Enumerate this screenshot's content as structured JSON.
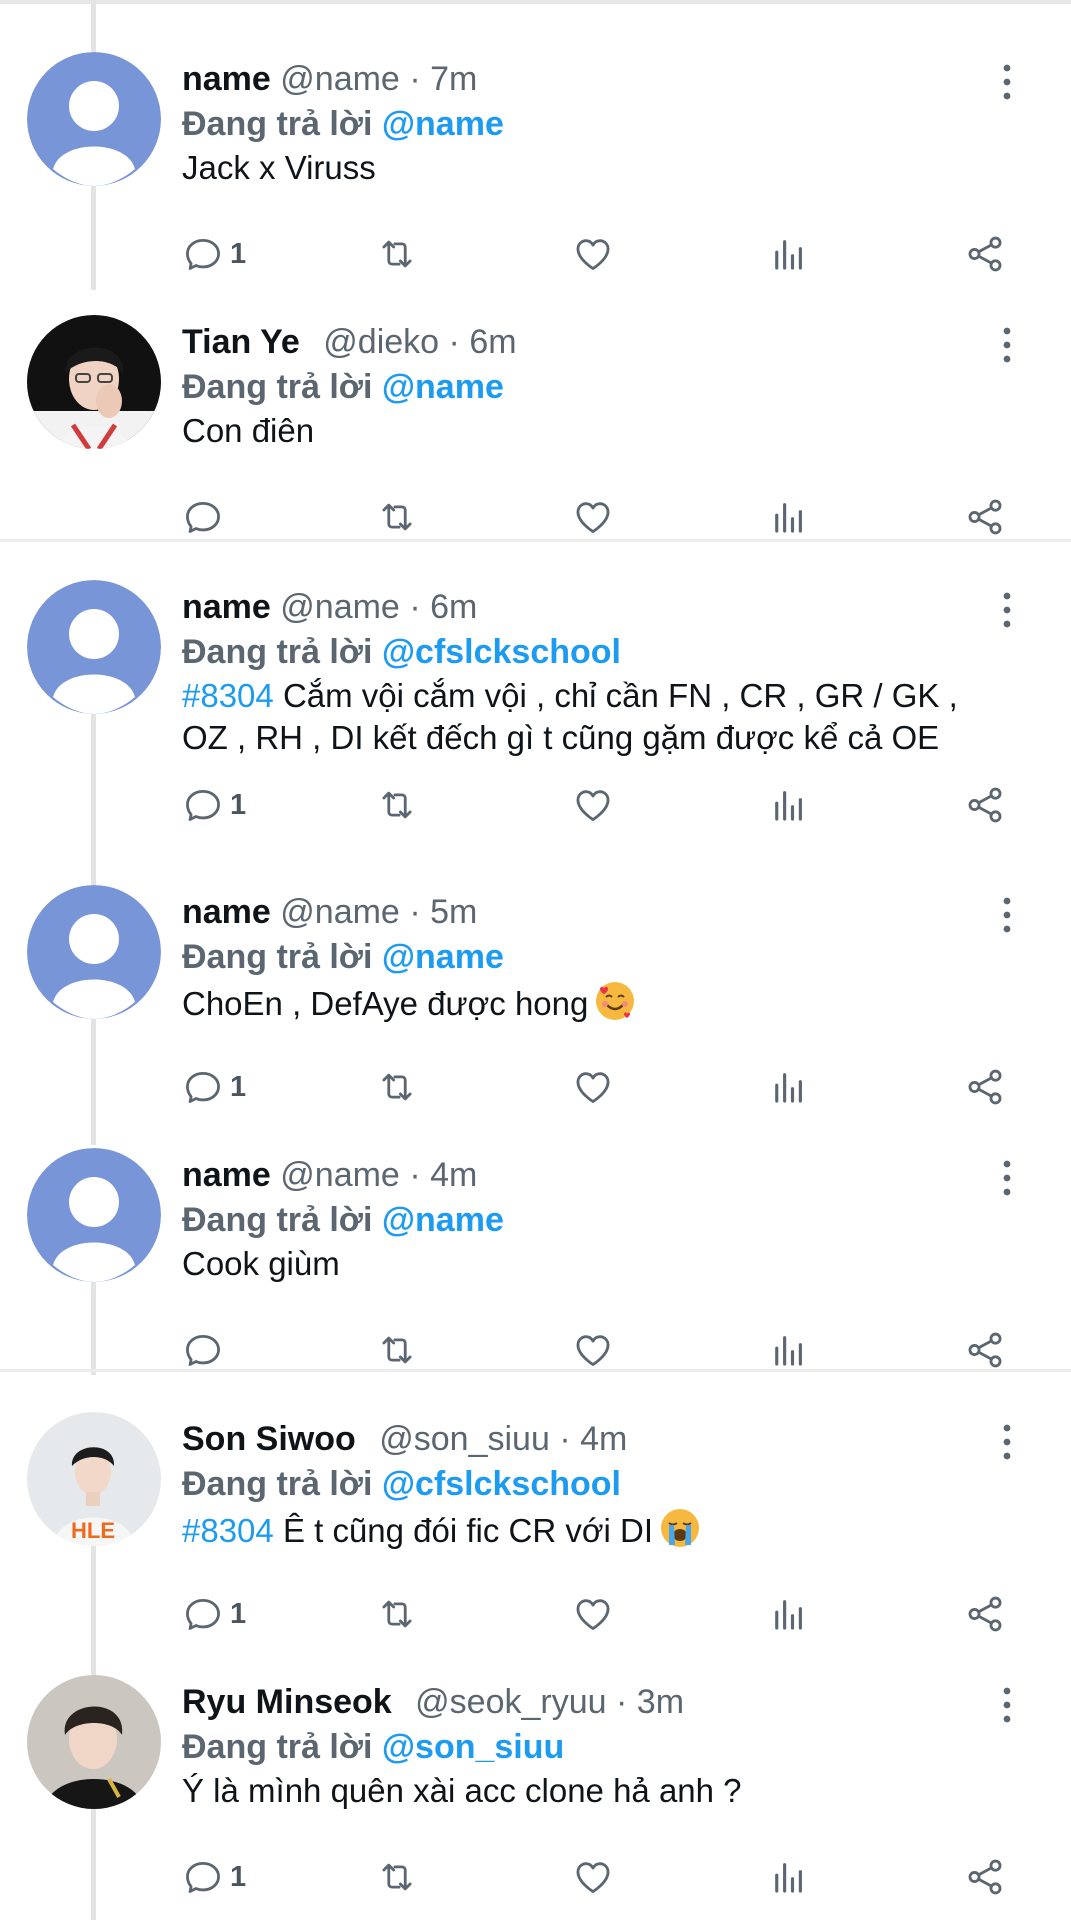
{
  "reply_prefix": "Đang trả lời ",
  "tweets": [
    {
      "display_name": "name",
      "handle": "@name",
      "separator": "·",
      "time": "7m",
      "reply_to": "@name",
      "hashtag": "",
      "text": "Jack x Viruss",
      "emoji": "",
      "reply_count": "1",
      "avatar": "default-avatar"
    },
    {
      "display_name": "Tian Ye",
      "handle": "@dieko",
      "separator": "·",
      "time": "6m",
      "reply_to": "@name",
      "hashtag": "",
      "text": "Con điên",
      "emoji": "",
      "reply_count": "",
      "avatar": "photo-avatar"
    },
    {
      "display_name": "name",
      "handle": "@name",
      "separator": "·",
      "time": "6m",
      "reply_to": "@cfslckschool",
      "hashtag": "#8304",
      "text": "Cắm vội cắm vội , chỉ cần FN , CR , GR / GK , OZ , RH , DI kết đếch gì t cũng gặm được kể cả OE",
      "emoji": "",
      "reply_count": "1",
      "avatar": "default-avatar"
    },
    {
      "display_name": "name",
      "handle": "@name",
      "separator": "·",
      "time": "5m",
      "reply_to": "@name",
      "hashtag": "",
      "text": "ChoEn , DefAye được hong",
      "emoji": "smiling-face-with-hearts",
      "reply_count": "1",
      "avatar": "default-avatar"
    },
    {
      "display_name": "name",
      "handle": "@name",
      "separator": "·",
      "time": "4m",
      "reply_to": "@name",
      "hashtag": "",
      "text": "Cook giùm",
      "emoji": "",
      "reply_count": "",
      "avatar": "default-avatar"
    },
    {
      "display_name": "Son Siwoo",
      "handle": "@son_siuu",
      "separator": "·",
      "time": "4m",
      "reply_to": "@cfslckschool",
      "hashtag": "#8304",
      "text": "Ê t cũng đói fic CR với DI",
      "emoji": "loudly-crying-face",
      "reply_count": "1",
      "avatar": "photo-avatar"
    },
    {
      "display_name": "Ryu Minseok",
      "handle": "@seok_ryuu",
      "separator": "·",
      "time": "3m",
      "reply_to": "@son_siuu",
      "hashtag": "",
      "text": "Ý là mình quên xài acc clone hả anh ?",
      "emoji": "",
      "reply_count": "1",
      "avatar": "photo-avatar"
    }
  ],
  "icons": {
    "reply": "reply-icon",
    "retweet": "retweet-icon",
    "like": "like-icon",
    "stats": "stats-icon",
    "share": "share-icon",
    "more": "more-icon"
  },
  "colors": {
    "link": "#1d9bf0",
    "secondary_text": "#5b6670",
    "icon": "#5b6670",
    "avatar_default": "#7895d8"
  }
}
